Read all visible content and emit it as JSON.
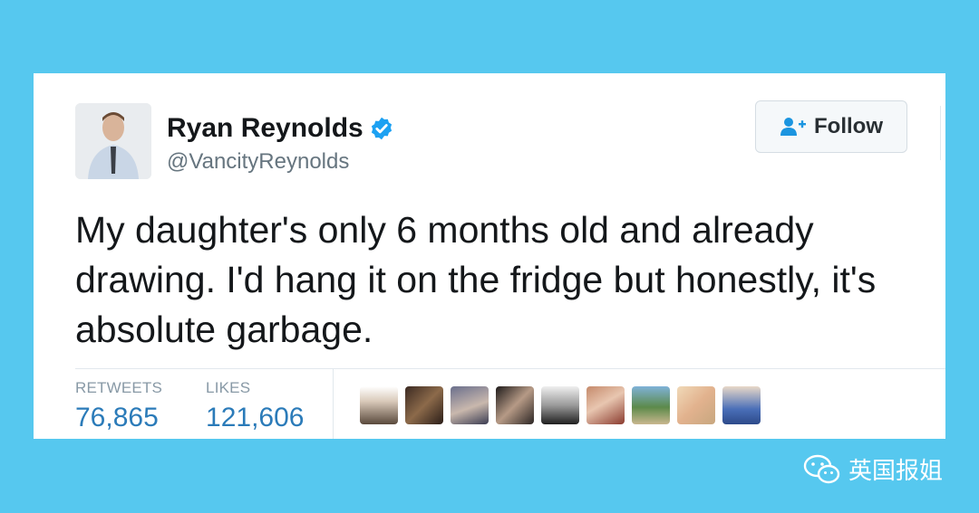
{
  "tweet": {
    "display_name": "Ryan Reynolds",
    "handle": "@VancityReynolds",
    "follow_label": "Follow",
    "text": "My daughter's only 6 months old and already drawing. I'd hang it on the fridge but honestly, it's absolute garbage.",
    "stats": {
      "retweets_label": "RETWEETS",
      "retweets_value": "76,865",
      "likes_label": "LIKES",
      "likes_value": "121,606"
    }
  },
  "watermark": {
    "label": "英国报姐"
  },
  "colors": {
    "background": "#56c8ef",
    "link_blue": "#2b7bb9",
    "verified_blue": "#1da1f2"
  },
  "icons": [
    "verified-icon",
    "follow-person-icon",
    "wechat-icon"
  ]
}
